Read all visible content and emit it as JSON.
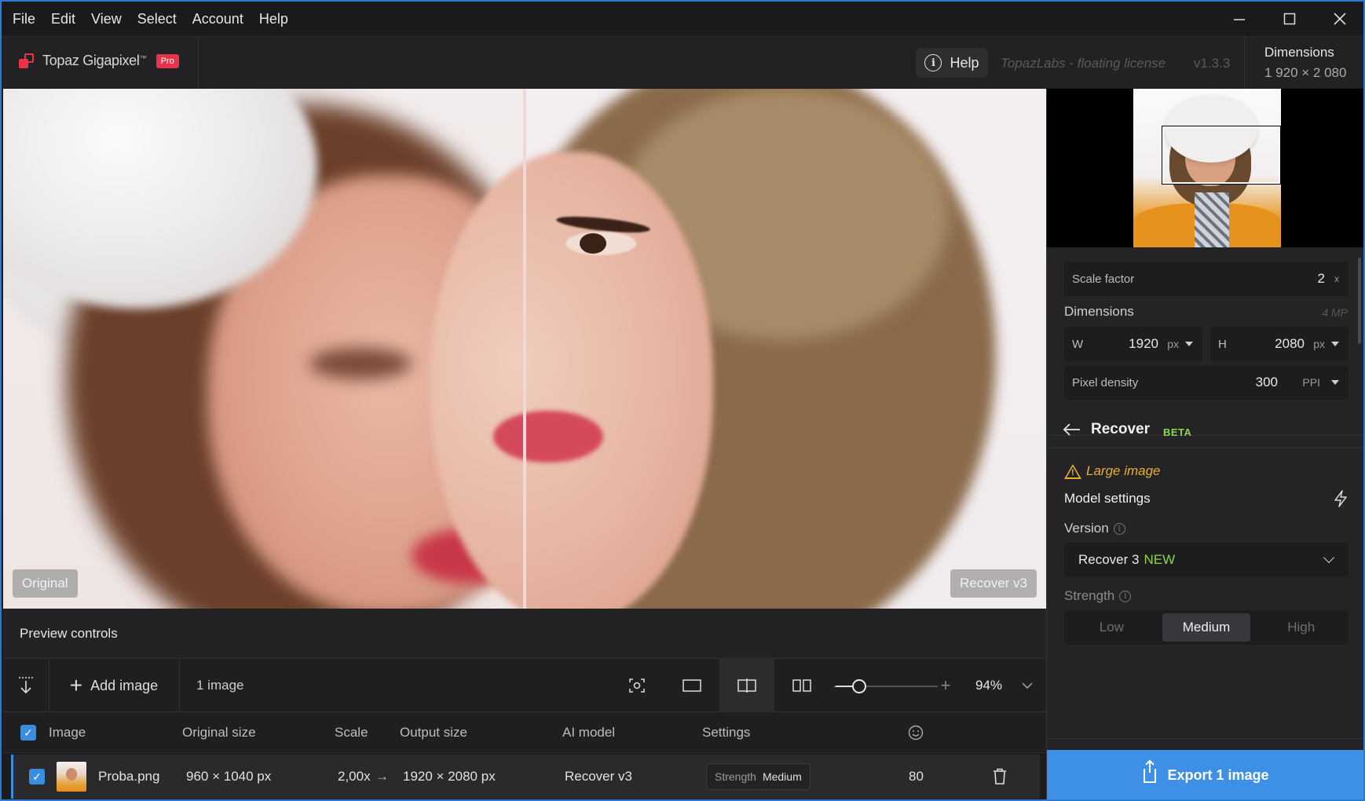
{
  "menu": {
    "items": [
      "File",
      "Edit",
      "View",
      "Select",
      "Account",
      "Help"
    ]
  },
  "window_controls": {
    "minimize_icon": "minimize-icon",
    "maximize_icon": "maximize-icon",
    "close_icon": "close-icon"
  },
  "header": {
    "app_name": "Topaz Gigapixel",
    "tm": "™",
    "badge": "Pro",
    "help_label": "Help",
    "license": "TopazLabs - floating license",
    "version": "v1.3.3",
    "dimensions_label": "Dimensions",
    "dimensions_value": "1 920 × 2 080"
  },
  "preview": {
    "left_label": "Original",
    "right_label": "Recover v3"
  },
  "preview_controls": {
    "title": "Preview controls"
  },
  "toolbar": {
    "add_image": "Add image",
    "image_count": "1 image",
    "zoom": "94%",
    "zoom_level": 0.2
  },
  "table": {
    "headers": {
      "image": "Image",
      "original_size": "Original size",
      "scale": "Scale",
      "output_size": "Output size",
      "ai_model": "AI model",
      "settings": "Settings"
    },
    "rows": [
      {
        "name": "Proba.png",
        "original_size": "960 × 1040 px",
        "scale": "2,00x",
        "arrow": "→",
        "output_size": "1920 × 2080 px",
        "ai_model": "Recover v3",
        "settings_key": "Strength",
        "settings_value": "Medium",
        "score": "80"
      }
    ]
  },
  "right_panel": {
    "scale_factor_label": "Scale factor",
    "scale_factor_value": "2",
    "scale_factor_unit": "x",
    "dimensions_label": "Dimensions",
    "megapixels": "4 MP",
    "width_label": "W",
    "width_value": "1920",
    "width_unit": "px",
    "height_label": "H",
    "height_value": "2080",
    "height_unit": "px",
    "density_label": "Pixel density",
    "density_value": "300",
    "density_unit": "PPI",
    "model_title": "Recover",
    "model_badge": "BETA",
    "warning": "Large image",
    "model_settings": "Model settings",
    "version_label": "Version",
    "version_value": "Recover 3",
    "version_new": "NEW",
    "strength_label": "Strength",
    "strength_options": [
      "Low",
      "Medium",
      "High"
    ],
    "strength_selected": "Medium",
    "export": "Export 1 image"
  },
  "colors": {
    "accent": "#3e8fe6",
    "brand": "#e8334a",
    "new": "#8ed44a",
    "warning": "#e6b02c"
  }
}
